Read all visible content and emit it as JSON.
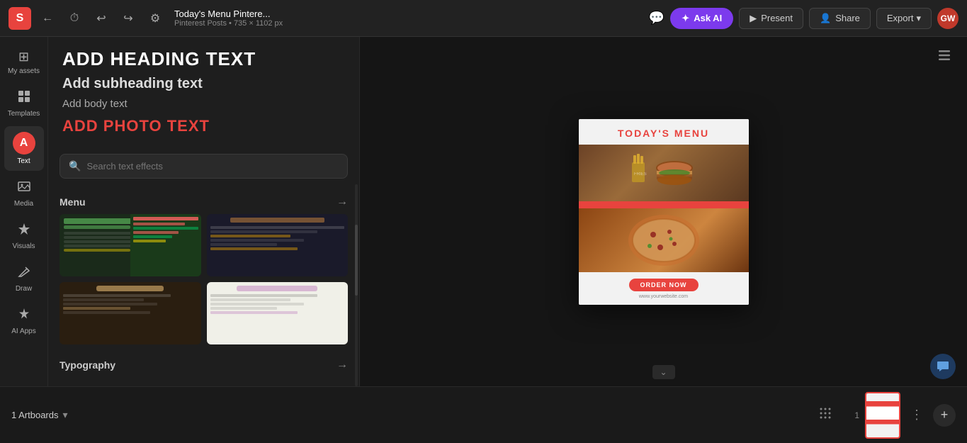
{
  "topbar": {
    "logo_letter": "S",
    "title": "Today's Menu Pintere...",
    "subtitle": "Pinterest Posts • 735 × 1102 px",
    "ask_ai_label": "Ask AI",
    "present_label": "Present",
    "share_label": "Share",
    "export_label": "Export",
    "avatar_initials": "GW",
    "back_icon": "←",
    "history_icon": "⏱",
    "undo_icon": "↩",
    "redo_icon": "↪",
    "settings_icon": "⚙",
    "chat_icon": "💬"
  },
  "sidebar": {
    "items": [
      {
        "id": "my-assets",
        "label": "My assets",
        "icon": "⊞"
      },
      {
        "id": "templates",
        "label": "Templates",
        "icon": "⊟"
      },
      {
        "id": "text",
        "label": "Text",
        "icon": "A",
        "active": true
      },
      {
        "id": "media",
        "label": "Media",
        "icon": "🖼"
      },
      {
        "id": "visuals",
        "label": "Visuals",
        "icon": "✦"
      },
      {
        "id": "draw",
        "label": "Draw",
        "icon": "✏"
      },
      {
        "id": "ai-apps",
        "label": "AI Apps",
        "icon": "✦"
      }
    ]
  },
  "text_panel": {
    "heading_label": "ADD HEADING TEXT",
    "subheading_label": "Add subheading text",
    "body_label": "Add body text",
    "photo_label": "ADD PHOTO TEXT",
    "search_placeholder": "Search text effects",
    "sections": [
      {
        "id": "menu",
        "label": "Menu",
        "templates": [
          {
            "id": "fruits-veg",
            "style": "dark-green"
          },
          {
            "id": "indian",
            "style": "dark-red"
          },
          {
            "id": "coffee",
            "style": "coffee"
          },
          {
            "id": "cursive",
            "style": "light"
          }
        ]
      },
      {
        "id": "typography",
        "label": "Typography"
      }
    ]
  },
  "canvas": {
    "artboard_title": "TODAY'S MENU",
    "order_btn_label": "ORDER NOW",
    "website_url": "www.yourwebsite.com",
    "chevron_icon": "⌄",
    "layers_icon": "⊞"
  },
  "bottom_bar": {
    "artboards_label": "1 Artboards",
    "page_number": "1",
    "add_page_icon": "+",
    "more_icon": "⋮"
  }
}
